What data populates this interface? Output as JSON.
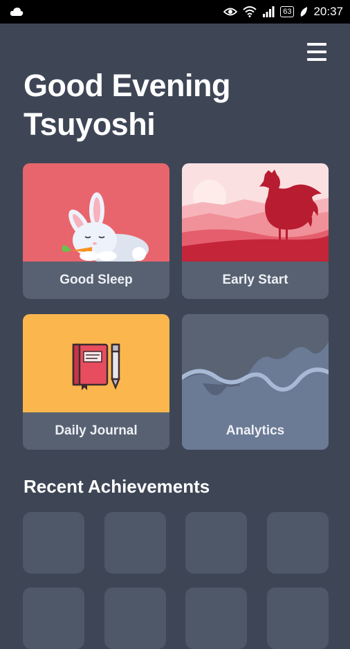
{
  "status_bar": {
    "time": "20:37",
    "battery": "63",
    "icons": [
      "cloud-icon",
      "eye-icon",
      "wifi-icon",
      "signal-icon",
      "battery-icon",
      "leaf-icon"
    ]
  },
  "header": {
    "greeting_line1": "Good Evening",
    "greeting_line2": "Tsuyoshi",
    "menu_icon": "hamburger-menu-icon"
  },
  "cards": [
    {
      "label": "Good Sleep",
      "color": "#e8656d"
    },
    {
      "label": "Early Start",
      "color": "#e84d5f"
    },
    {
      "label": "Daily Journal",
      "color": "#fbb74d"
    },
    {
      "label": "Analytics",
      "color": "#6b7a95"
    }
  ],
  "achievements": {
    "title": "Recent Achievements"
  },
  "colors": {
    "background": "#3e4656",
    "card_footer": "#576172",
    "placeholder": "#4f5868"
  }
}
